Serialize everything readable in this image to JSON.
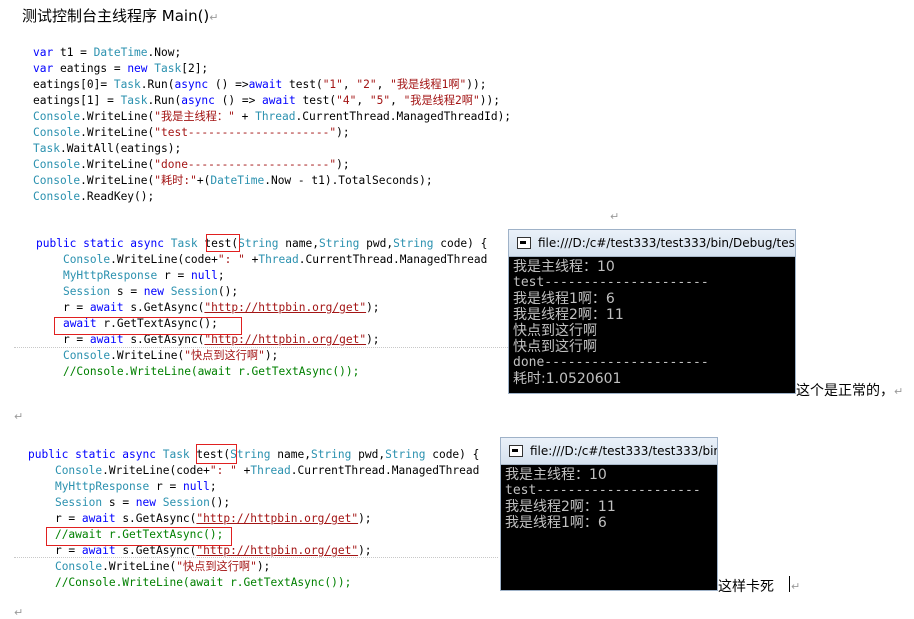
{
  "heading": "测试控制台主线程序 Main()",
  "para_mark": "↵",
  "main_code": [
    [
      [
        "k",
        "var "
      ],
      [
        "",
        "t1 = "
      ],
      [
        "t",
        "DateTime"
      ],
      [
        "",
        ".Now;"
      ]
    ],
    [
      [
        "k",
        "var "
      ],
      [
        "",
        "eatings = "
      ],
      [
        "k",
        "new "
      ],
      [
        "t",
        "Task"
      ],
      [
        "",
        "[2];"
      ]
    ],
    [
      [
        "",
        "eatings[0]= "
      ],
      [
        "t",
        "Task"
      ],
      [
        "",
        ".Run("
      ],
      [
        "k",
        "async "
      ],
      [
        "",
        "() =>"
      ],
      [
        "k",
        "await "
      ],
      [
        "",
        "test("
      ],
      [
        "s",
        "\"1\""
      ],
      [
        "",
        ", "
      ],
      [
        "s",
        "\"2\""
      ],
      [
        "",
        ", "
      ],
      [
        "s",
        "\"我是线程1啊\""
      ],
      [
        "",
        "));"
      ]
    ],
    [
      [
        "",
        "eatings[1] = "
      ],
      [
        "t",
        "Task"
      ],
      [
        "",
        ".Run("
      ],
      [
        "k",
        "async "
      ],
      [
        "",
        "() => "
      ],
      [
        "k",
        "await "
      ],
      [
        "",
        "test("
      ],
      [
        "s",
        "\"4\""
      ],
      [
        "",
        ", "
      ],
      [
        "s",
        "\"5\""
      ],
      [
        "",
        ", "
      ],
      [
        "s",
        "\"我是线程2啊\""
      ],
      [
        "",
        "));"
      ]
    ],
    [
      [
        "t",
        "Console"
      ],
      [
        "",
        ".WriteLine("
      ],
      [
        "s",
        "\"我是主线程：\""
      ],
      [
        "",
        " + "
      ],
      [
        "t",
        "Thread"
      ],
      [
        "",
        ".CurrentThread.ManagedThreadId);"
      ]
    ],
    [
      [
        "t",
        "Console"
      ],
      [
        "",
        ".WriteLine("
      ],
      [
        "s",
        "\"test---------------------\""
      ],
      [
        "",
        ");"
      ]
    ],
    [
      [
        "t",
        "Task"
      ],
      [
        "",
        ".WaitAll(eatings);"
      ]
    ],
    [
      [
        "t",
        "Console"
      ],
      [
        "",
        ".WriteLine("
      ],
      [
        "s",
        "\"done---------------------\""
      ],
      [
        "",
        ");"
      ]
    ],
    [
      [
        "t",
        "Console"
      ],
      [
        "",
        ".WriteLine("
      ],
      [
        "s",
        "\"耗时:\""
      ],
      [
        "",
        "+("
      ],
      [
        "t",
        "DateTime"
      ],
      [
        "",
        ".Now - t1).TotalSeconds);"
      ]
    ],
    [
      [
        "t",
        "Console"
      ],
      [
        "",
        ".ReadKey();"
      ]
    ]
  ],
  "block1_code": [
    [
      [
        "k",
        "public static async "
      ],
      [
        "t",
        "Task "
      ],
      [
        "",
        "test"
      ],
      [
        "",
        "("
      ],
      [
        "t",
        "String "
      ],
      [
        "",
        "name,"
      ],
      [
        "t",
        "String "
      ],
      [
        "",
        "pwd,"
      ],
      [
        "t",
        "String "
      ],
      [
        "",
        "code) {"
      ]
    ],
    [
      [
        "",
        "    "
      ],
      [
        "t",
        "Console"
      ],
      [
        "",
        ".WriteLine(code+"
      ],
      [
        "s",
        "\": \""
      ],
      [
        "",
        " +"
      ],
      [
        "t",
        "Thread"
      ],
      [
        "",
        ".CurrentThread.ManagedThread"
      ]
    ],
    [
      [
        "",
        "    "
      ],
      [
        "t",
        "MyHttpResponse "
      ],
      [
        "",
        "r = "
      ],
      [
        "k",
        "null"
      ],
      [
        "",
        ";"
      ]
    ],
    [
      [
        "",
        "    "
      ],
      [
        "t",
        "Session "
      ],
      [
        "",
        "s = "
      ],
      [
        "k",
        "new "
      ],
      [
        "t",
        "Session"
      ],
      [
        "",
        "();"
      ]
    ],
    [
      [
        "",
        "    r = "
      ],
      [
        "k",
        "await "
      ],
      [
        "",
        "s.GetAsync("
      ],
      [
        "u",
        "\"http://httpbin.org/get\""
      ],
      [
        "",
        ");"
      ]
    ],
    [
      [
        "",
        "    "
      ],
      [
        "k",
        "await "
      ],
      [
        "",
        "r.GetTextAsync();"
      ]
    ],
    [
      [
        "",
        "    r = "
      ],
      [
        "k",
        "await "
      ],
      [
        "",
        "s.GetAsync("
      ],
      [
        "u",
        "\"http://httpbin.org/get\""
      ],
      [
        "",
        ");"
      ]
    ],
    [
      [
        "",
        "    "
      ],
      [
        "t",
        "Console"
      ],
      [
        "",
        ".WriteLine("
      ],
      [
        "s",
        "\"快点到这行啊\""
      ],
      [
        "",
        ");"
      ]
    ],
    [
      [
        "",
        "    "
      ],
      [
        "c",
        "//Console.WriteLine(await r.GetTextAsync());"
      ]
    ]
  ],
  "block2_code": [
    [
      [
        "k",
        "public static async "
      ],
      [
        "t",
        "Task "
      ],
      [
        "",
        "test"
      ],
      [
        "",
        "("
      ],
      [
        "t",
        "String "
      ],
      [
        "",
        "name,"
      ],
      [
        "t",
        "String "
      ],
      [
        "",
        "pwd,"
      ],
      [
        "t",
        "String "
      ],
      [
        "",
        "code) {"
      ]
    ],
    [
      [
        "",
        "    "
      ],
      [
        "t",
        "Console"
      ],
      [
        "",
        ".WriteLine(code+"
      ],
      [
        "s",
        "\": \""
      ],
      [
        "",
        " +"
      ],
      [
        "t",
        "Thread"
      ],
      [
        "",
        ".CurrentThread.ManagedThread"
      ]
    ],
    [
      [
        "",
        "    "
      ],
      [
        "t",
        "MyHttpResponse "
      ],
      [
        "",
        "r = "
      ],
      [
        "k",
        "null"
      ],
      [
        "",
        ";"
      ]
    ],
    [
      [
        "",
        "    "
      ],
      [
        "t",
        "Session "
      ],
      [
        "",
        "s = "
      ],
      [
        "k",
        "new "
      ],
      [
        "t",
        "Session"
      ],
      [
        "",
        "();"
      ]
    ],
    [
      [
        "",
        "    r = "
      ],
      [
        "k",
        "await "
      ],
      [
        "",
        "s.GetAsync("
      ],
      [
        "u",
        "\"http://httpbin.org/get\""
      ],
      [
        "",
        ");"
      ]
    ],
    [
      [
        "",
        "    "
      ],
      [
        "c",
        "//await r.GetTextAsync();"
      ]
    ],
    [
      [
        "",
        "    r = "
      ],
      [
        "k",
        "await "
      ],
      [
        "",
        "s.GetAsync("
      ],
      [
        "u",
        "\"http://httpbin.org/get\""
      ],
      [
        "",
        ");"
      ]
    ],
    [
      [
        "",
        "    "
      ],
      [
        "t",
        "Console"
      ],
      [
        "",
        ".WriteLine("
      ],
      [
        "s",
        "\"快点到这行啊\""
      ],
      [
        "",
        ");"
      ]
    ],
    [
      [
        "",
        "    "
      ],
      [
        "c",
        "//Console.WriteLine(await r.GetTextAsync());"
      ]
    ]
  ],
  "console1": {
    "title": "file:///D:/c#/test333/test333/bin/Debug/test",
    "lines": [
      "我是主线程：10",
      "test---------------------",
      "我是线程1啊：6",
      "我是线程2啊：11",
      "快点到这行啊",
      "快点到这行啊",
      "done---------------------",
      "耗时:1.0520601"
    ]
  },
  "console2": {
    "title": "file:///D:/c#/test333/test333/bin/",
    "lines": [
      "我是主线程：10",
      "test---------------------",
      "我是线程2啊：11",
      "我是线程1啊：6"
    ]
  },
  "note1": "这个是正常的，",
  "note2": "这样卡死"
}
